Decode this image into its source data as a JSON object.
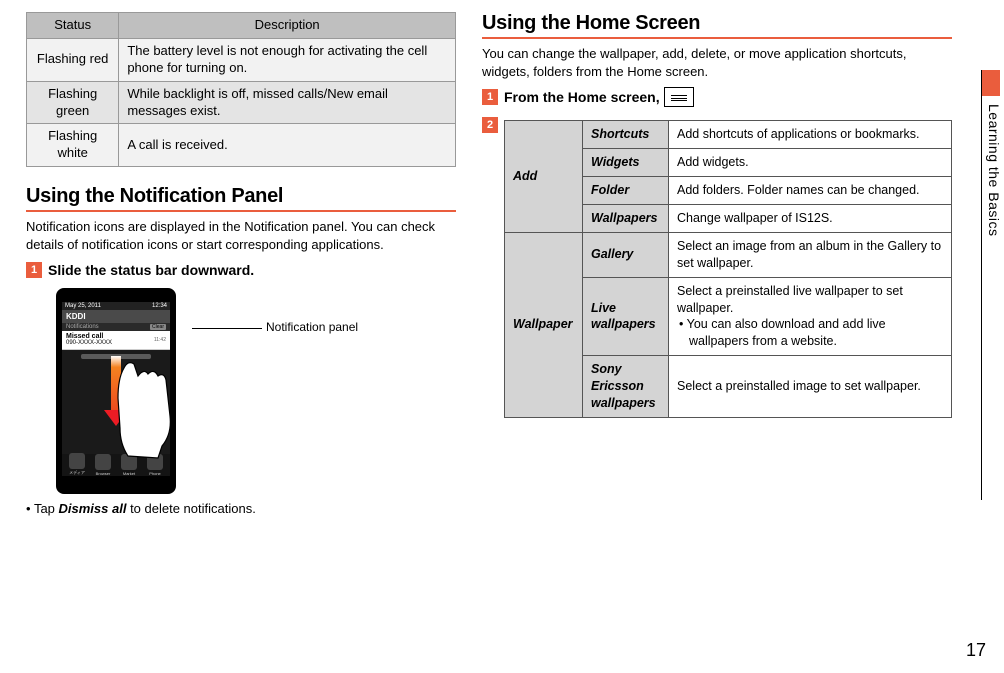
{
  "side_tab": "Learning the Basics",
  "page_number": "17",
  "status_table": {
    "headers": [
      "Status",
      "Description"
    ],
    "rows": [
      {
        "status": "Flashing red",
        "desc": "The battery level is not enough for activating the cell phone for turning on."
      },
      {
        "status": "Flashing green",
        "desc": "While backlight is off, missed calls/New email messages exist."
      },
      {
        "status": "Flashing white",
        "desc": "A call is received."
      }
    ]
  },
  "notification_section": {
    "heading": "Using the Notification Panel",
    "intro": "Notification icons are displayed in the Notification panel. You can check details of notification icons or start corresponding applications.",
    "step1_num": "1",
    "step1_title": "Slide the status bar downward.",
    "callout": "Notification panel",
    "phone": {
      "status_left": "May 25, 2011",
      "status_right": "12:34",
      "carrier": "KDDI",
      "notifications_label": "Notifications",
      "clear": "Clear",
      "notif_title": "Missed call",
      "notif_sub": "090-XXXX-XXXX",
      "notif_time": "11:42",
      "dock": [
        "メディア",
        "Browser",
        "Market",
        "Phone"
      ]
    },
    "bullet_prefix": "Tap ",
    "bullet_em": "Dismiss all",
    "bullet_suffix": " to delete notifications."
  },
  "home_section": {
    "heading": "Using the Home Screen",
    "intro": "You can change the wallpaper, add, delete, or move application shortcuts, widgets, folders from the Home screen.",
    "step1_num": "1",
    "step1_title": "From the Home screen, ",
    "step2_num": "2",
    "table": {
      "groups": [
        {
          "name": "Add",
          "rows": [
            {
              "sub": "Shortcuts",
              "desc": "Add shortcuts of applications or bookmarks."
            },
            {
              "sub": "Widgets",
              "desc": "Add widgets."
            },
            {
              "sub": "Folder",
              "desc": "Add folders. Folder names can be changed."
            },
            {
              "sub": "Wallpapers",
              "desc": "Change wallpaper of IS12S."
            }
          ]
        },
        {
          "name": "Wallpaper",
          "rows": [
            {
              "sub": "Gallery",
              "desc": "Select an image from an album in the Gallery to set wallpaper."
            },
            {
              "sub": "Live wallpapers",
              "desc": "Select a preinstalled live wallpaper to set wallpaper.",
              "bullet": "You can also download and add live wallpapers from a website."
            },
            {
              "sub": "Sony Ericsson wallpapers",
              "desc": "Select a preinstalled image to set wallpaper."
            }
          ]
        }
      ]
    }
  }
}
